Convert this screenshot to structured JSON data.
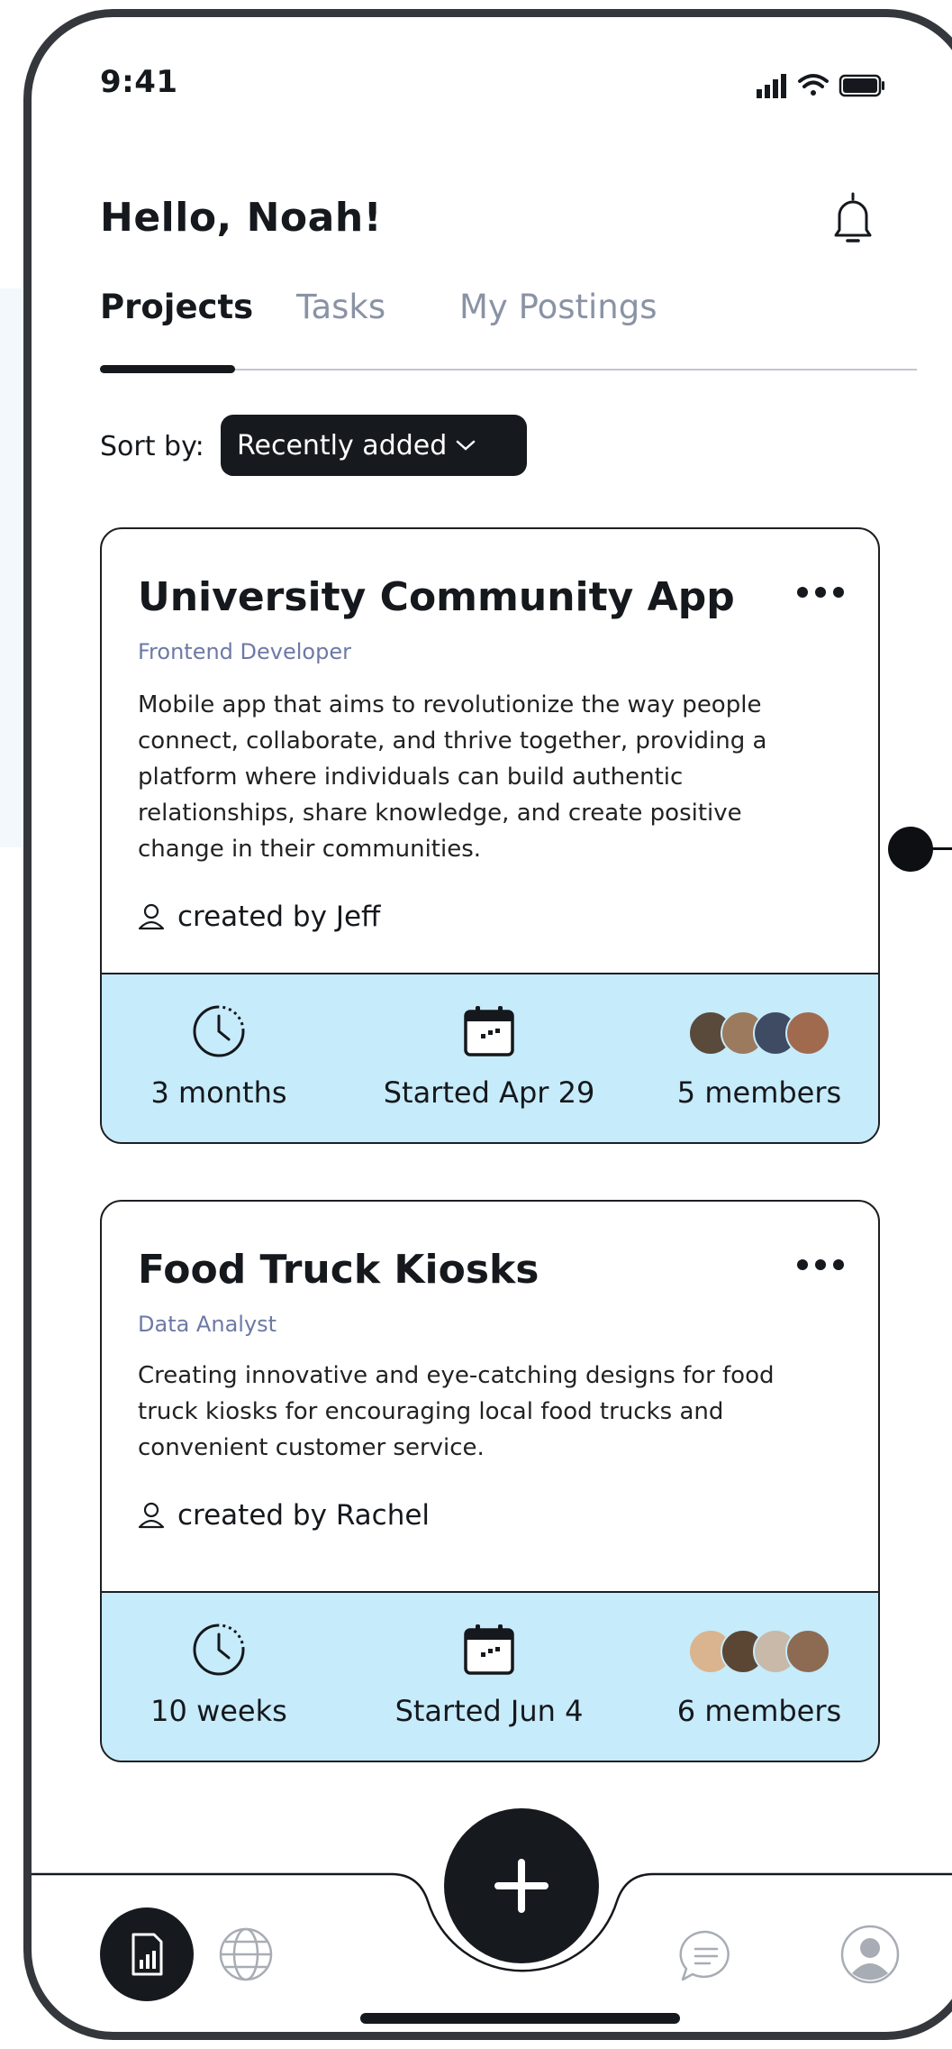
{
  "status_bar": {
    "time": "9:41"
  },
  "header": {
    "greeting": "Hello, Noah!"
  },
  "tabs": [
    {
      "label": "Projects",
      "active": true
    },
    {
      "label": "Tasks",
      "active": false
    },
    {
      "label": "My Postings",
      "active": false
    }
  ],
  "sort": {
    "label": "Sort by:",
    "value": "Recently added"
  },
  "projects": [
    {
      "title": "University Community App",
      "role": "Frontend Developer",
      "description": "Mobile app that aims to revolutionize the way people connect, collaborate, and thrive together, providing a platform where individuals can build authentic relationships, share knowledge, and create positive change in their communities.",
      "creator": "created by Jeff",
      "duration": "3 months",
      "started": "Started Apr 29",
      "members": "5 members"
    },
    {
      "title": "Food Truck Kiosks",
      "role": "Data Analyst",
      "description": "Creating innovative and eye-catching designs for food truck kiosks for encouraging local food trucks and convenient customer service.",
      "creator": "created by Rachel",
      "duration": "10 weeks",
      "started": "Started Jun 4",
      "members": "6 members"
    }
  ],
  "bottom_nav": {
    "items": [
      "projects-icon",
      "globe-icon",
      "add-icon",
      "chat-icon",
      "profile-icon"
    ],
    "active": "projects-icon"
  },
  "colors": {
    "accent": "#161a1f",
    "stats_bg": "#c6ebfa",
    "muted": "#8a93a5"
  }
}
